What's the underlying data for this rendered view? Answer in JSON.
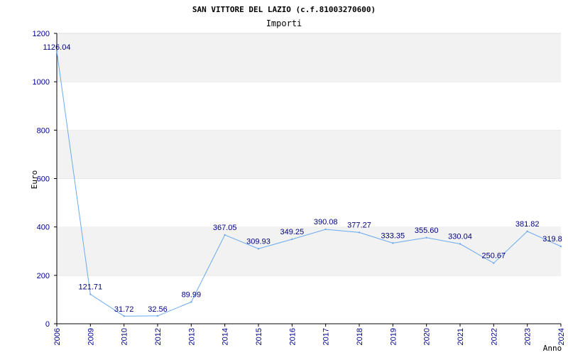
{
  "chart_data": {
    "type": "line",
    "title": "SAN VITTORE DEL LAZIO (c.f.81003270600)",
    "subtitle": "Importi",
    "xlabel": "Anno",
    "ylabel": "Euro",
    "ylim": [
      0,
      1200
    ],
    "yticks": [
      0,
      200,
      400,
      600,
      800,
      1000,
      1200
    ],
    "grid": true,
    "categories": [
      "2006",
      "2009",
      "2010",
      "2012",
      "2013",
      "2014",
      "2015",
      "2016",
      "2017",
      "2018",
      "2019",
      "2020",
      "2021",
      "2022",
      "2023",
      "2024"
    ],
    "series": [
      {
        "values": [
          1126.04,
          121.71,
          31.72,
          32.56,
          89.99,
          367.05,
          309.93,
          349.25,
          390.08,
          377.27,
          333.35,
          355.6,
          330.04,
          250.67,
          381.82,
          319.8
        ],
        "labels": [
          "1126.04",
          "121.71",
          "31.72",
          "32.56",
          "89.99",
          "367.05",
          "309.93",
          "349.25",
          "390.08",
          "377.27",
          "333.35",
          "355.60",
          "330.04",
          "250.67",
          "381.82",
          "319.8"
        ]
      }
    ],
    "colors": {
      "line": "#6aaaf0",
      "band_shaded": "#f2f2f2",
      "band_plain": "#ffffff",
      "tick_text": "#00008b",
      "data_label": "#000080",
      "axis": "#000000"
    }
  }
}
